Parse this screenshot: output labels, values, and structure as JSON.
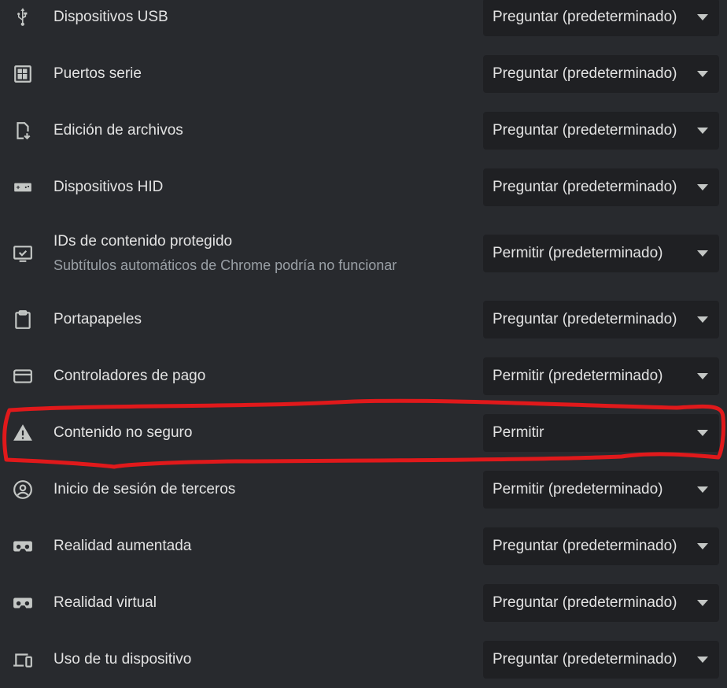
{
  "permissions": [
    {
      "label": "Dispositivos USB",
      "icon": "usb-icon",
      "value": "Preguntar (predeterminado)"
    },
    {
      "label": "Puertos serie",
      "icon": "serial-port-icon",
      "value": "Preguntar (predeterminado)"
    },
    {
      "label": "Edición de archivos",
      "icon": "file-edit-icon",
      "value": "Preguntar (predeterminado)"
    },
    {
      "label": "Dispositivos HID",
      "icon": "gamepad-icon",
      "value": "Preguntar (predeterminado)"
    },
    {
      "label": "IDs de contenido protegido",
      "sublabel": "Subtítulos automáticos de Chrome podría no funcionar",
      "icon": "monitor-check-icon",
      "value": "Permitir (predeterminado)"
    },
    {
      "label": "Portapapeles",
      "icon": "clipboard-icon",
      "value": "Preguntar (predeterminado)"
    },
    {
      "label": "Controladores de pago",
      "icon": "credit-card-icon",
      "value": "Permitir (predeterminado)"
    },
    {
      "label": "Contenido no seguro",
      "icon": "warning-icon",
      "value": "Permitir"
    },
    {
      "label": "Inicio de sesión de terceros",
      "icon": "account-circle-icon",
      "value": "Permitir (predeterminado)"
    },
    {
      "label": "Realidad aumentada",
      "icon": "vr-headset-icon",
      "value": "Preguntar (predeterminado)"
    },
    {
      "label": "Realidad virtual",
      "icon": "vr-headset-icon",
      "value": "Preguntar (predeterminado)"
    },
    {
      "label": "Uso de tu dispositivo",
      "icon": "devices-icon",
      "value": "Preguntar (predeterminado)"
    }
  ],
  "colors": {
    "background": "#282a2e",
    "select_background": "#1f2023",
    "annotation": "#e0191b"
  }
}
